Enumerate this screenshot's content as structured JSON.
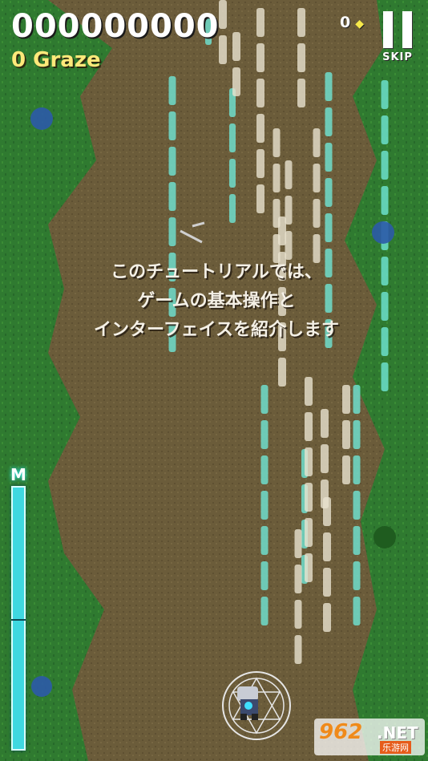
{
  "hud": {
    "score": "000000000",
    "graze": "0 Graze",
    "gem_count": "0",
    "gem_icon": "diamond-icon",
    "skip_label": "SKIP",
    "meter_label": "M",
    "meter_level": 1.0
  },
  "tutorial": {
    "lines": [
      "このチュートリアルでは、",
      "ゲームの基本操作と",
      "インターフェイスを紹介します"
    ]
  },
  "watermark": {
    "brand": "962",
    "suffix": ".NET",
    "sub": "乐游网"
  },
  "colors": {
    "grass": "#2f7a30",
    "dirt": "#6b5c3a",
    "laser_cyan": "#6fe6d6",
    "laser_white": "#e8e2cf",
    "meter": "#3fd8e0",
    "graze_text": "#ffe97a"
  }
}
